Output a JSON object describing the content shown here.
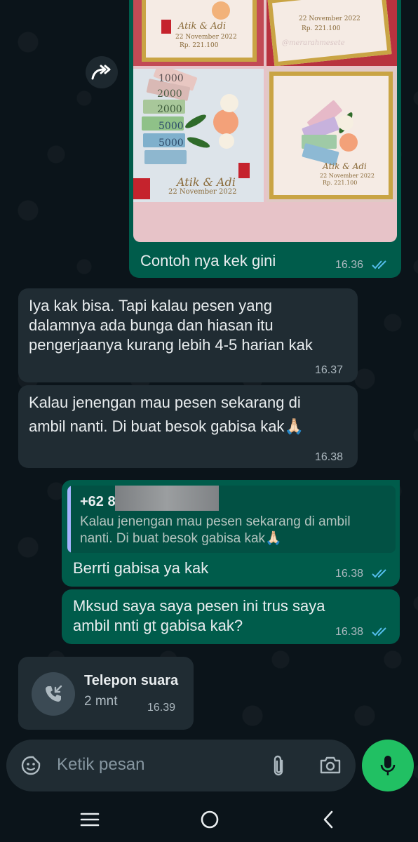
{
  "messages": {
    "image_caption": {
      "text": "Contoh nya kek gini",
      "time": "16.36"
    },
    "in_1": {
      "text_line1": "Iya kak bisa. Tapi kalau pesen yang",
      "text_line2": "dalamnya ada bunga dan hiasan itu",
      "text_line3": "pengerjaanya kurang lebih 4-5 harian kak",
      "time": "16.37"
    },
    "in_2": {
      "text_line1": "Kalau jenengan mau pesen sekarang di",
      "text_line2": "ambil nanti. Di buat besok gabisa kak",
      "emoji": "🙏🏻",
      "time": "16.38"
    },
    "reply": {
      "quote_name": "+62 8",
      "quote_line1": "Kalau jenengan mau pesen sekarang di ambil",
      "quote_line2": "nanti. Di buat besok gabisa kak",
      "quote_emoji": "🙏🏻",
      "text": "Berrti gabisa ya kak",
      "time": "16.38"
    },
    "out_2": {
      "text_line1": "Mksud saya saya pesen ini trus saya",
      "text_line2": "ambil nnti gt gabisa kak?",
      "time": "16.38"
    },
    "call": {
      "title": "Telepon suara",
      "duration": "2 mnt",
      "time": "16.39"
    }
  },
  "image_overlay": {
    "names": "Atik & Adi",
    "date": "22 November 2022",
    "amount": "Rp. 221.100",
    "watermark": "@merarahmesete",
    "banknote_1": "1000",
    "banknote_2": "2000",
    "banknote_3": "2000",
    "banknote_4": "5000",
    "banknote_5": "5000"
  },
  "composer": {
    "placeholder": "Ketik pesan"
  },
  "icons": {
    "forward": "forward-icon",
    "sticker": "sticker-icon",
    "attach": "paperclip-icon",
    "camera": "camera-icon",
    "mic": "mic-icon",
    "call": "incoming-call-icon",
    "nav_menu": "menu-icon",
    "nav_home": "home-icon",
    "nav_back": "back-icon"
  },
  "colors": {
    "background": "#0b141a",
    "incoming_bubble": "#202c33",
    "outgoing_bubble": "#005c4b",
    "read_ticks": "#53bdeb",
    "accent_green": "#21c063"
  }
}
